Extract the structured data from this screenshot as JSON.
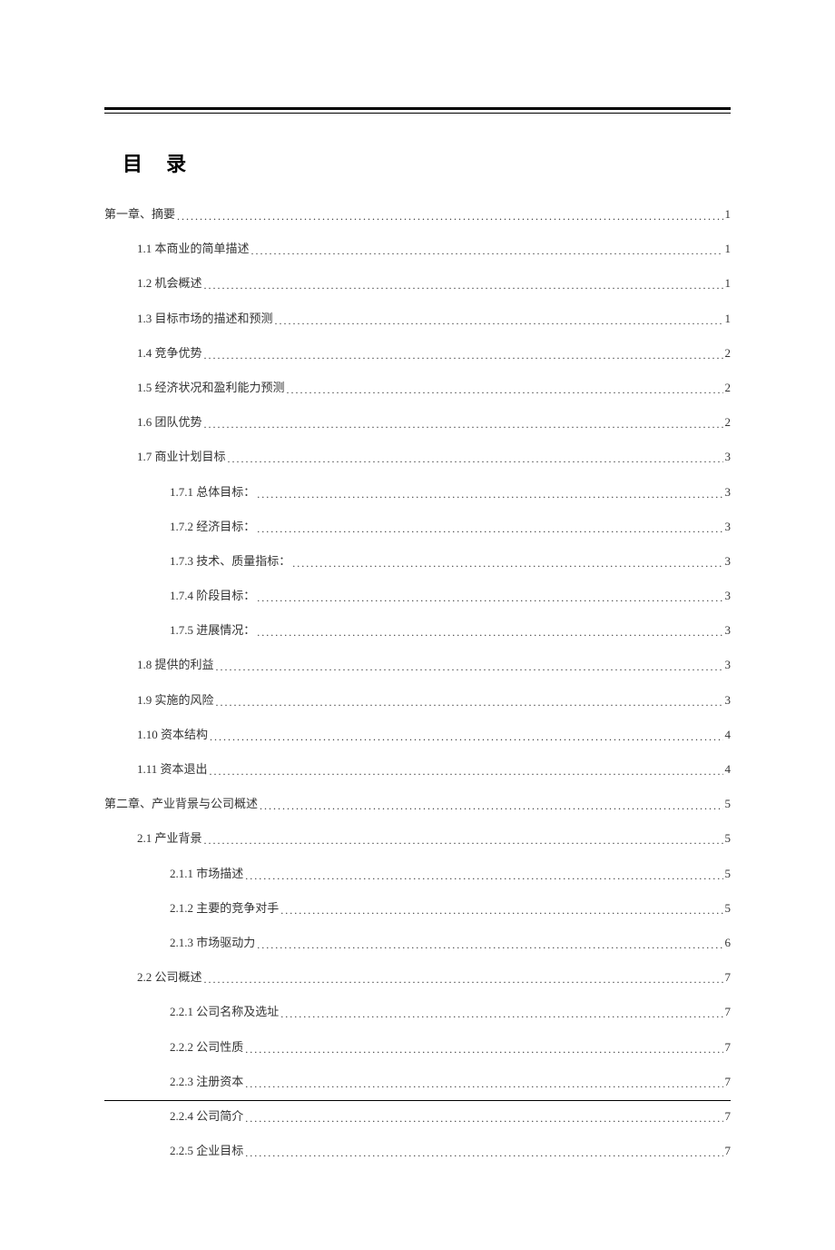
{
  "title": "目 录",
  "toc": [
    {
      "level": 0,
      "label": "第一章、摘要",
      "page": "1"
    },
    {
      "level": 1,
      "label": "1.1 本商业的简单描述",
      "page": "1"
    },
    {
      "level": 1,
      "label": "1.2 机会概述",
      "page": "1"
    },
    {
      "level": 1,
      "label": "1.3 目标市场的描述和预测",
      "page": "1"
    },
    {
      "level": 1,
      "label": "1.4 竞争优势",
      "page": "2"
    },
    {
      "level": 1,
      "label": "1.5 经济状况和盈利能力预测",
      "page": "2"
    },
    {
      "level": 1,
      "label": "1.6 团队优势",
      "page": "2"
    },
    {
      "level": 1,
      "label": "1.7 商业计划目标",
      "page": "3"
    },
    {
      "level": 2,
      "label": "1.7.1 总体目标：",
      "page": "3"
    },
    {
      "level": 2,
      "label": "1.7.2 经济目标：",
      "page": "3"
    },
    {
      "level": 2,
      "label": "1.7.3 技术、质量指标：",
      "page": "3"
    },
    {
      "level": 2,
      "label": "1.7.4 阶段目标：",
      "page": "3"
    },
    {
      "level": 2,
      "label": "1.7.5 进展情况：",
      "page": "3"
    },
    {
      "level": 1,
      "label": "1.8 提供的利益",
      "page": "3"
    },
    {
      "level": 1,
      "label": "1.9 实施的风险",
      "page": "3"
    },
    {
      "level": 1,
      "label": "1.10 资本结构",
      "page": "4"
    },
    {
      "level": 1,
      "label": "1.11 资本退出",
      "page": "4"
    },
    {
      "level": 0,
      "label": "第二章、产业背景与公司概述",
      "page": "5"
    },
    {
      "level": 1,
      "label": "2.1 产业背景",
      "page": "5"
    },
    {
      "level": 2,
      "label": "2.1.1 市场描述",
      "page": "5"
    },
    {
      "level": 2,
      "label": "2.1.2 主要的竞争对手",
      "page": "5"
    },
    {
      "level": 2,
      "label": "2.1.3 市场驱动力",
      "page": "6"
    },
    {
      "level": 1,
      "label": "2.2 公司概述",
      "page": "7"
    },
    {
      "level": 2,
      "label": "2.2.1 公司名称及选址",
      "page": "7"
    },
    {
      "level": 2,
      "label": "2.2.2 公司性质",
      "page": "7"
    },
    {
      "level": 2,
      "label": "2.2.3 注册资本",
      "page": "7"
    },
    {
      "level": 2,
      "label": "2.2.4 公司简介",
      "page": "7"
    },
    {
      "level": 2,
      "label": "2.2.5 企业目标",
      "page": "7"
    }
  ]
}
